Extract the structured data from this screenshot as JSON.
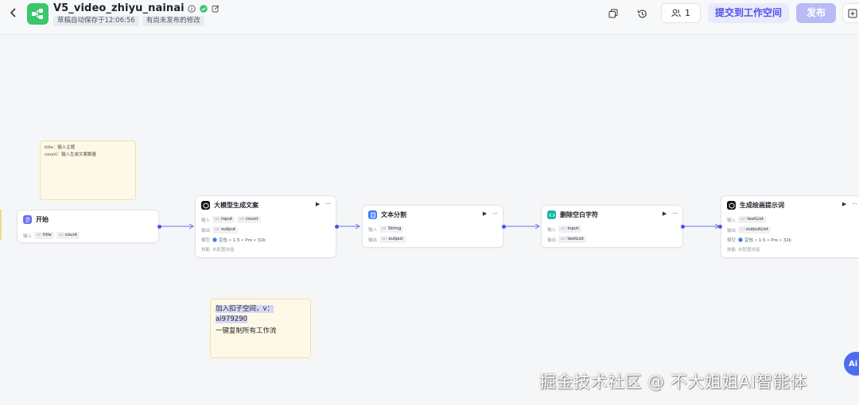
{
  "header": {
    "back_icon": "chevron-left-icon",
    "app_icon": "workflow-icon",
    "title": "V5_video_zhiyu_nainai",
    "status_autosave": "草稿自动保存于12:06:56",
    "status_unpublished": "有尚未发布的修改",
    "collab_count": "1",
    "submit_label": "提交到工作空间",
    "publish_label": "发布",
    "colors": {
      "accent": "#4d53e8",
      "logo": "#3ac66a",
      "verified": "#3ac66a"
    }
  },
  "notes": [
    {
      "lines": [
        "title：输入主题",
        "count：输入生成文案数量"
      ]
    },
    {
      "line1": "加入扣子空间，v：",
      "line2": "ai979290",
      "line3": "一键复制所有工作流"
    }
  ],
  "nodes": {
    "start": {
      "title": "开始",
      "input_label": "输入",
      "inputs": [
        {
          "type": "str",
          "name": "title"
        },
        {
          "type": "int",
          "name": "count"
        }
      ]
    },
    "llm": {
      "title": "大模型生成文案",
      "input_label": "输入",
      "inputs": [
        {
          "type": "str",
          "name": "input"
        },
        {
          "type": "int",
          "name": "count"
        }
      ],
      "output_label": "输出",
      "outputs": [
        {
          "type": "str",
          "name": "output"
        }
      ],
      "model_label": "模型",
      "model": "豆包 • 1.5 • Pro • 32k",
      "skill_label": "技能",
      "skill_value": "未配置技能"
    },
    "split": {
      "title": "文本分割",
      "input_label": "输入",
      "inputs": [
        {
          "type": "str",
          "name": "String"
        }
      ],
      "output_label": "输出",
      "outputs": [
        {
          "type": "arr",
          "name": "output"
        }
      ]
    },
    "remove_space": {
      "title": "删除空白字符",
      "input_label": "输入",
      "inputs": [
        {
          "type": "arr",
          "name": "input"
        }
      ],
      "output_label": "输出",
      "outputs": [
        {
          "type": "arr",
          "name": "textList"
        }
      ]
    },
    "draw_prompt": {
      "title": "生成绘画提示词",
      "input_label": "输入",
      "inputs": [
        {
          "type": "arr",
          "name": "textList"
        }
      ],
      "output_label": "输出",
      "outputs": [
        {
          "type": "[ ]",
          "name": "outputList"
        }
      ],
      "model_label": "模型",
      "model": "豆包 • 1.5 • Pro • 32k",
      "skill_label": "技能",
      "skill_value": "未配置技能"
    }
  },
  "watermark": "掘金技术社区 @ 不大姐姐AI智能体",
  "fab_label": "Ai"
}
